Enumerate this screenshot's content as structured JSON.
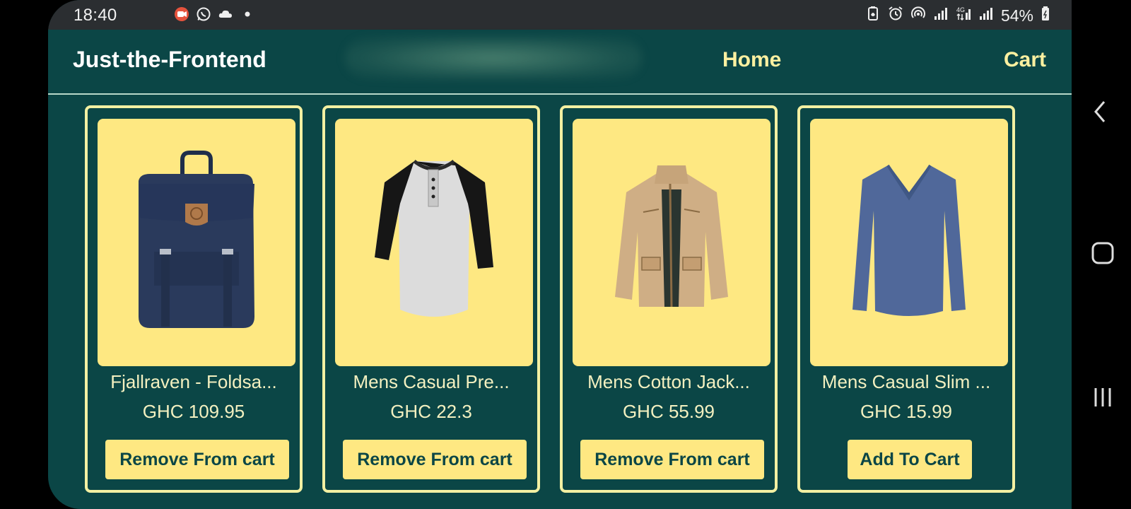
{
  "status_bar": {
    "time": "18:40",
    "battery": "54%",
    "network": "4G",
    "left_icons": [
      "screen-recorder-icon",
      "whatsapp-icon",
      "cloud-icon",
      "dot-icon"
    ],
    "right_icons": [
      "battery-saver-icon",
      "alarm-icon",
      "hotspot-icon",
      "signal-icon",
      "signal-4g-icon",
      "signal-icon-2",
      "battery-icon"
    ]
  },
  "navbar": {
    "brand": "Just-the-Frontend",
    "links": [
      "Home",
      "Cart"
    ]
  },
  "products": [
    {
      "title": "Fjallraven - Foldsa...",
      "price": "GHC 109.95",
      "button": "Remove From cart",
      "image": "backpack-image"
    },
    {
      "title": "Mens Casual Pre...",
      "price": "GHC 22.3",
      "button": "Remove From cart",
      "image": "raglan-tshirt-image"
    },
    {
      "title": "Mens Cotton Jack...",
      "price": "GHC 55.99",
      "button": "Remove From cart",
      "image": "cotton-jacket-image"
    },
    {
      "title": "Mens Casual Slim ...",
      "price": "GHC 15.99",
      "button": "Add To Cart",
      "image": "slim-fit-shirt-image"
    }
  ],
  "colors": {
    "background": "#0b4646",
    "card_border": "#f3f0a2",
    "image_bg": "#fee882",
    "button_bg": "#fee882",
    "nav_link": "#fdf0a0",
    "text": "#f3f0c0"
  },
  "system_nav": [
    "back-icon",
    "home-icon",
    "recents-icon"
  ]
}
